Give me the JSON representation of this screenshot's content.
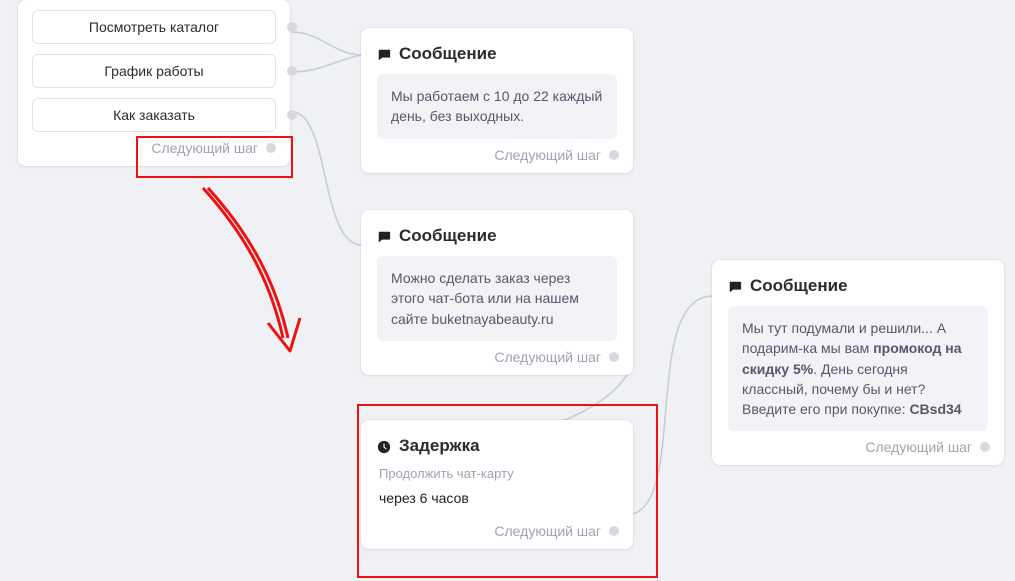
{
  "common": {
    "next_label": "Следующий шаг"
  },
  "options": {
    "items": [
      {
        "label": "Посмотреть каталог"
      },
      {
        "label": "График работы"
      },
      {
        "label": "Как заказать"
      }
    ]
  },
  "msg1": {
    "title": "Сообщение",
    "body": "Мы работаем с 10 до 22 каждый день, без выходных."
  },
  "msg2": {
    "title": "Сообщение",
    "body": "Можно сделать заказ через этого чат-бота или на нашем сайте buketnayabeauty.ru"
  },
  "delay": {
    "title": "Задержка",
    "hint": "Продолжить чат-карту",
    "body": "через 6 часов"
  },
  "msg3": {
    "title": "Сообщение",
    "body_pre": "Мы тут подумали и решили... А подарим-ка мы вам ",
    "body_bold1": "промокод на скидку 5%",
    "body_mid": ". День сегодня классный, почему бы и нет? Введите его при покупке: ",
    "body_bold2": "CBsd34"
  }
}
